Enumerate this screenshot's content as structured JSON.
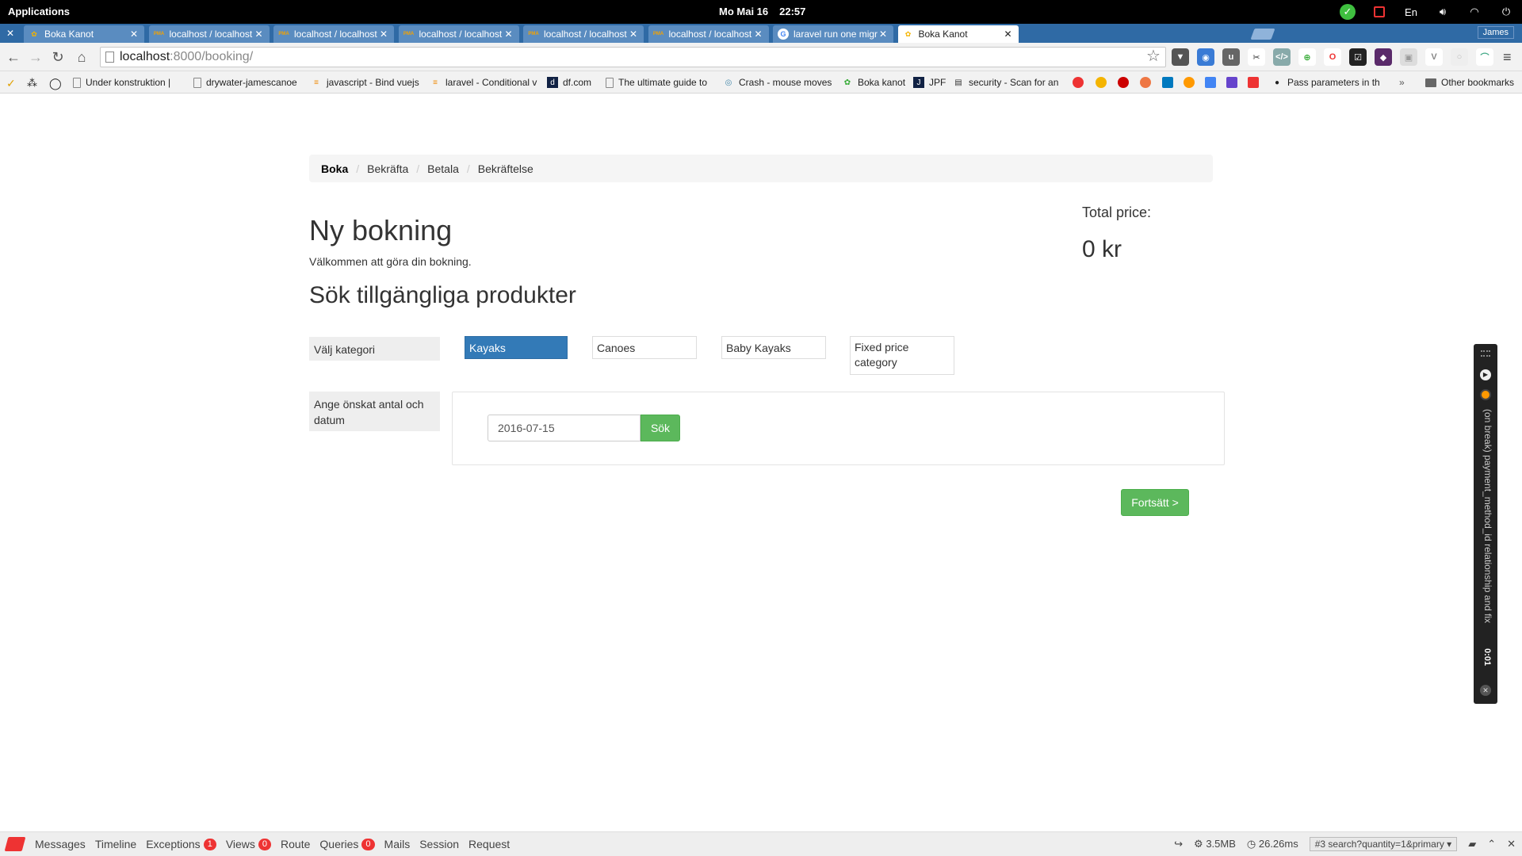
{
  "os_bar": {
    "apps_label": "Applications",
    "date": "Mo Mai 16",
    "time": "22:57",
    "lang": "En"
  },
  "tabs": [
    {
      "title": "Boka Kanot",
      "favicon": "boka",
      "active": false
    },
    {
      "title": "localhost / localhost / bok",
      "favicon": "pma",
      "active": false
    },
    {
      "title": "localhost / localhost / bok",
      "favicon": "pma",
      "active": false
    },
    {
      "title": "localhost / localhost / bok",
      "favicon": "pma",
      "active": false
    },
    {
      "title": "localhost / localhost / bok",
      "favicon": "pma",
      "active": false
    },
    {
      "title": "localhost / localhost / bok",
      "favicon": "pma",
      "active": false
    },
    {
      "title": "laravel run one migration",
      "favicon": "g",
      "active": false
    },
    {
      "title": "Boka Kanot",
      "favicon": "boka",
      "active": true
    }
  ],
  "profile_name": "James",
  "url": {
    "host": "localhost",
    "path": ":8000/booking/"
  },
  "bookmarks": [
    {
      "label": "Under konstruktion |"
    },
    {
      "label": "drywater-jamescanoe"
    },
    {
      "label": "javascript - Bind vuejs"
    },
    {
      "label": "laravel - Conditional v"
    },
    {
      "label": "df.com"
    },
    {
      "label": "The ultimate guide to"
    },
    {
      "label": "Crash - mouse moves"
    },
    {
      "label": "Boka kanot"
    },
    {
      "label": "JPF"
    },
    {
      "label": "security - Scan for an"
    },
    {
      "label": "Pass parameters in th"
    },
    {
      "label": "Other bookmarks"
    }
  ],
  "breadcrumb": [
    "Boka",
    "Bekräfta",
    "Betala",
    "Bekräftelse"
  ],
  "page": {
    "title": "Ny bokning",
    "welcome": "Välkommen att göra din bokning.",
    "subtitle": "Sök tillgängliga produkter"
  },
  "price": {
    "label": "Total price:",
    "value": "0 kr"
  },
  "category": {
    "label": "Välj kategori",
    "options": [
      "Kayaks",
      "Canoes",
      "Baby Kayaks",
      "Fixed price category"
    ],
    "selected": "Kayaks"
  },
  "search": {
    "label": "Ange önskat antal och datum",
    "date_value": "2016-07-15",
    "button": "Sök"
  },
  "continue_button": "Fortsätt >",
  "widget": {
    "text": "(on break) payment_method_id relationship and fix",
    "time": "0:01"
  },
  "debugbar": {
    "tabs": [
      {
        "label": "Messages"
      },
      {
        "label": "Timeline"
      },
      {
        "label": "Exceptions",
        "badge": "1"
      },
      {
        "label": "Views",
        "badge": "0"
      },
      {
        "label": "Route"
      },
      {
        "label": "Queries",
        "badge": "0"
      },
      {
        "label": "Mails"
      },
      {
        "label": "Session"
      },
      {
        "label": "Request"
      }
    ],
    "memory": "3.5MB",
    "duration": "26.26ms",
    "request": "#3 search?quantity=1&primary"
  },
  "colors": {
    "accent": "#337ab7",
    "success": "#5cb85c",
    "tabstrip": "#2f6aa5",
    "badge": "#e33333"
  }
}
